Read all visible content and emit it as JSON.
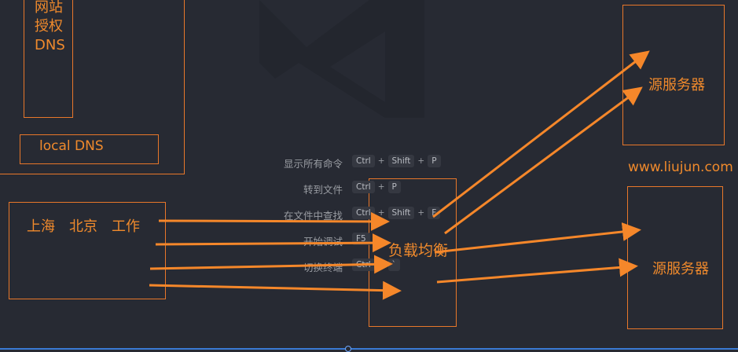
{
  "welcome": {
    "commands": [
      {
        "label": "显示所有命令",
        "keys": [
          "Ctrl",
          "Shift",
          "P"
        ]
      },
      {
        "label": "转到文件",
        "keys": [
          "Ctrl",
          "P"
        ]
      },
      {
        "label": "在文件中查找",
        "keys": [
          "Ctrl",
          "Shift",
          "F"
        ]
      },
      {
        "label": "开始调试",
        "keys": [
          "F5"
        ]
      },
      {
        "label": "切换终端",
        "keys": [
          "Ctrl",
          "`"
        ]
      }
    ],
    "plus": "+"
  },
  "annotations": {
    "auth_dns": "网站\n授权\nDNS",
    "auth_dns_lines": [
      "网站",
      "授权",
      "DNS"
    ],
    "local_dns": "local DNS",
    "cities": "上海　北京　工作",
    "load_balancer": "负载均衡",
    "origin_server_1": "源服务器",
    "origin_server_2": "源服务器",
    "domain": "www.liujun.com"
  },
  "colors": {
    "annotation": "#f08a2c",
    "background": "#272a33",
    "accent": "#3a7bd5"
  }
}
